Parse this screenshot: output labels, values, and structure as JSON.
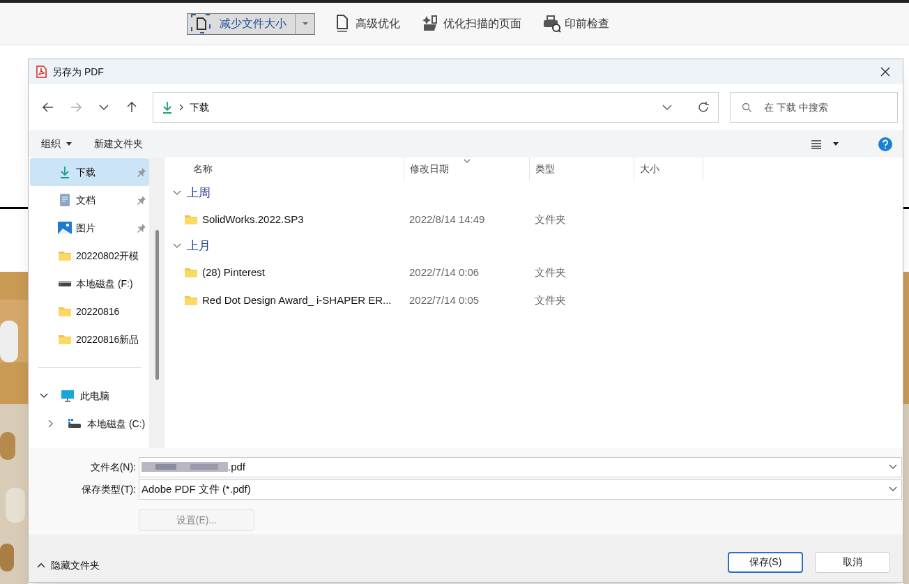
{
  "app_toolbar": [
    {
      "label": "减少文件大小",
      "kind": "split",
      "selected": true
    },
    {
      "label": "高级优化",
      "kind": "plain",
      "selected": false
    },
    {
      "label": "优化扫描的页面",
      "kind": "plain",
      "selected": false
    },
    {
      "label": "印前检查",
      "kind": "plain",
      "selected": false
    }
  ],
  "dialog": {
    "title": "另存为 PDF",
    "address": {
      "path": [
        "下载"
      ]
    },
    "search": {
      "placeholder": "在 下载 中搜索"
    },
    "command_bar": {
      "organize": "组织",
      "new_folder": "新建文件夹"
    },
    "sidebar": {
      "items": [
        {
          "kind": "download",
          "label": "下载",
          "pinned": true,
          "selected": true
        },
        {
          "kind": "document",
          "label": "文档",
          "pinned": true,
          "selected": false
        },
        {
          "label": "图片",
          "pinned": true,
          "selected": false
        },
        {
          "kind": "folder",
          "label": "20220802开模",
          "pinned": false,
          "selected": false
        },
        {
          "kind": "drive",
          "label": "本地磁盘 (F:)",
          "pinned": false,
          "selected": false
        },
        {
          "kind": "folder",
          "label": "20220816",
          "pinned": false,
          "selected": false
        },
        {
          "kind": "folder",
          "label": "20220816新品",
          "pinned": false,
          "selected": false
        }
      ],
      "tree": [
        {
          "kind": "pc",
          "label": "此电脑",
          "expanded": true,
          "selected": false,
          "children": [
            {
              "kind": "sysdrive",
              "label": "本地磁盘 (C:)",
              "expanded": false,
              "selected": false
            }
          ]
        }
      ]
    },
    "columns": [
      "名称",
      "修改日期",
      "类型",
      "大小"
    ],
    "groups": [
      {
        "label": "上周",
        "expanded": true,
        "rows": [
          {
            "name": "SolidWorks.2022.SP3",
            "modified": "2022/8/14 14:49",
            "type": "文件夹"
          }
        ]
      },
      {
        "label": "上月",
        "expanded": true,
        "rows": [
          {
            "name": "(28) Pinterest",
            "modified": "2022/7/14 0:06",
            "type": "文件夹"
          },
          {
            "name": "Red Dot Design Award_ i-SHAPER ER...",
            "modified": "2022/7/14 0:05",
            "type": "文件夹"
          }
        ]
      }
    ],
    "file_name": {
      "label": "文件名(N):",
      "value": ".pdf"
    },
    "save_type": {
      "label": "保存类型(T):",
      "value": "Adobe PDF 文件 (*.pdf)"
    },
    "settings_button": {
      "label": "设置(E)...",
      "disabled": true
    },
    "hide_folders": "隐藏文件夹",
    "buttons": [
      {
        "label": "保存(S)",
        "primary": true
      },
      {
        "label": "取消",
        "primary": false
      }
    ]
  }
}
